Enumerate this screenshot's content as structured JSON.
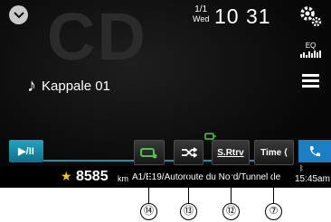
{
  "source": {
    "watermark": "CD"
  },
  "header": {
    "date_md": "1/1",
    "date_dow": "Wed",
    "clock": "10 31",
    "eq_label": "EQ"
  },
  "track": {
    "title": "Kappale 01"
  },
  "controls": {
    "play_pause_label": "▶/II",
    "source_retriever_label": "S.Rtrv",
    "time_label": "Time ⟨",
    "colors": {
      "accent": "#1e9ab8",
      "phone": "#1b7fc6",
      "green": "#4cc44c"
    }
  },
  "navbar": {
    "distance": "8585",
    "unit": "km",
    "road": "A1/E19/Autoroute du Nord/Tunnel de",
    "time": "15:45am"
  },
  "callouts": [
    "⑭",
    "⑬",
    "⑫",
    "⑦"
  ],
  "icons": [
    "chevron-down-icon",
    "settings-gears-icon",
    "eq-icon",
    "menu-icon",
    "music-note-icon",
    "navi-icon",
    "shuffle-icon",
    "phone-icon",
    "bluetooth-icon",
    "star-icon"
  ]
}
